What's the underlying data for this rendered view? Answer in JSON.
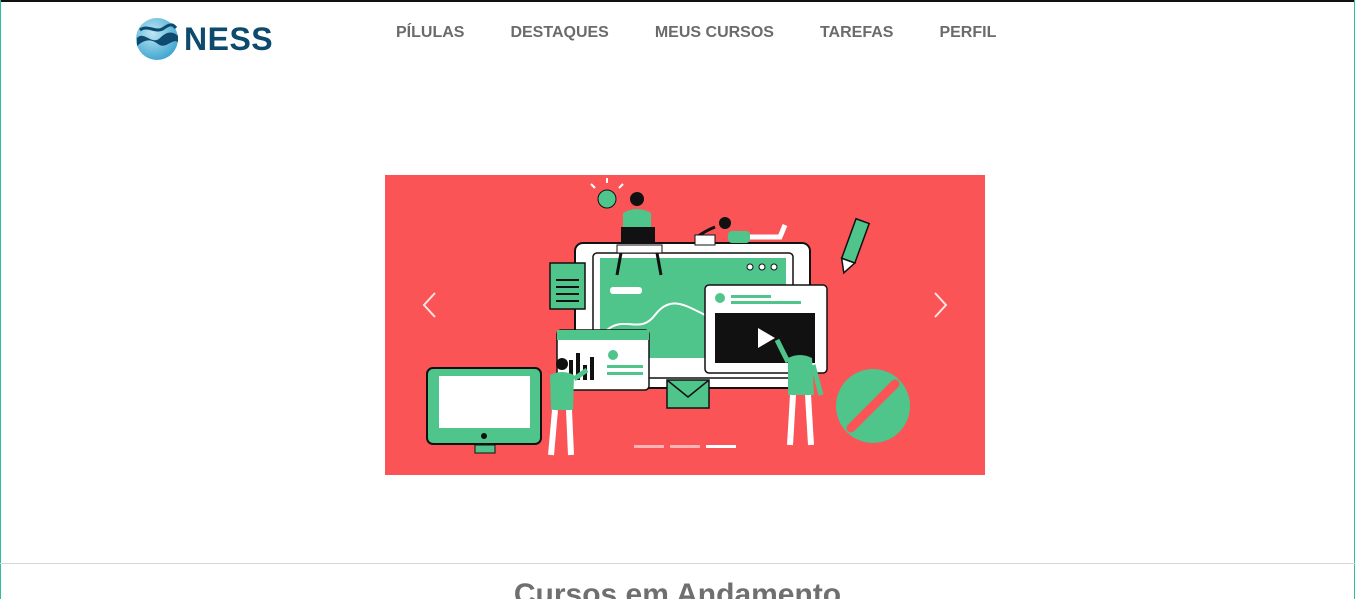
{
  "brand": {
    "name": "NESS",
    "logo_icon": "wave-globe-icon",
    "color": "#0d4a6e"
  },
  "nav": {
    "items": [
      {
        "label": "PÍLULAS"
      },
      {
        "label": "DESTAQUES"
      },
      {
        "label": "MEUS CURSOS"
      },
      {
        "label": "TAREFAS"
      },
      {
        "label": "PERFIL"
      }
    ]
  },
  "carousel": {
    "background": "#fa5457",
    "accent": "#4fc48b",
    "prev_icon": "chevron-left-icon",
    "next_icon": "chevron-right-icon",
    "slide_count": 3,
    "active_slide": 3
  },
  "section": {
    "title": "Cursos em Andamento"
  }
}
